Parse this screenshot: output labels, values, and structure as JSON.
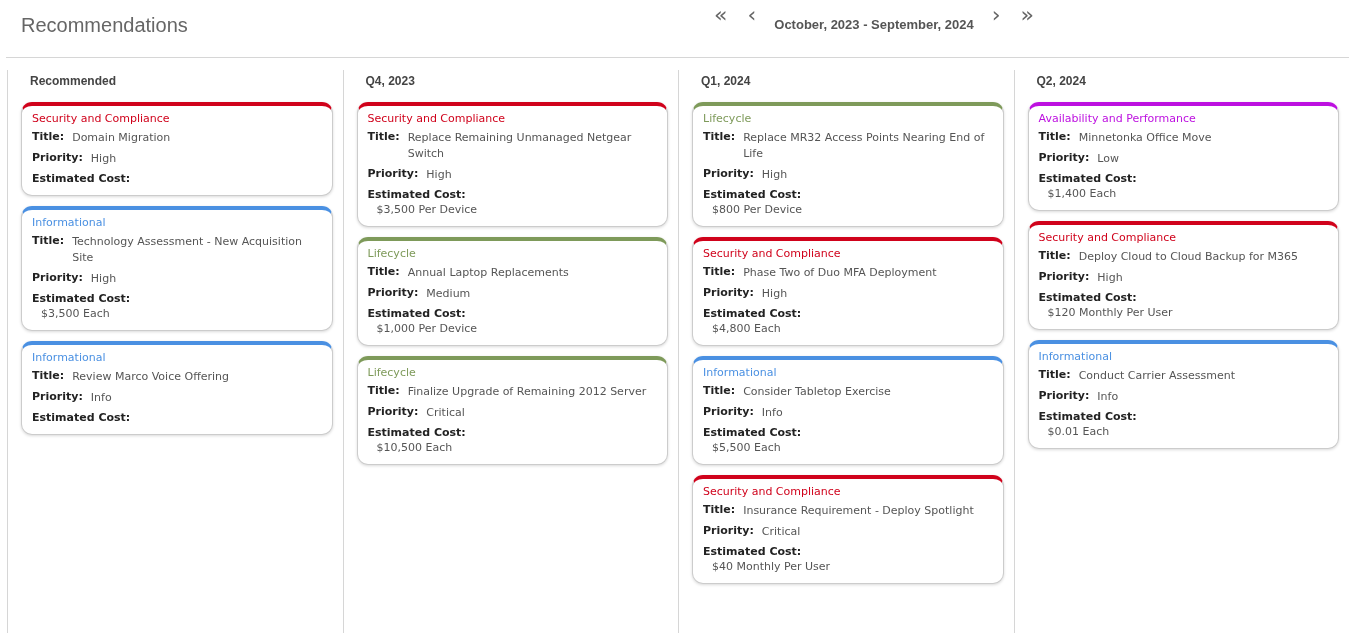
{
  "header": {
    "title": "Recommendations",
    "nav": {
      "first": "«",
      "prev": "‹",
      "range": "October, 2023 - September, 2024",
      "next": "›",
      "last": "»"
    }
  },
  "columns": [
    {
      "heading": "Recommended",
      "cards": [
        {
          "category": "Security and Compliance",
          "color": "#d0021b",
          "title_label": "Title:",
          "title": "Domain Migration",
          "priority_label": "Priority:",
          "priority": "High",
          "cost_label": "Estimated Cost:"
        },
        {
          "category": "Informational",
          "color": "#4a90e2",
          "title_label": "Title:",
          "title": "Technology Assessment - New Acquisition Site",
          "priority_label": "Priority:",
          "priority": "High",
          "cost_label": "Estimated Cost:",
          "cost": "$3,500 Each"
        },
        {
          "category": "Informational",
          "color": "#4a90e2",
          "title_label": "Title:",
          "title": "Review Marco Voice Offering",
          "priority_label": "Priority:",
          "priority": "Info",
          "cost_label": "Estimated Cost:"
        }
      ]
    },
    {
      "heading": "Q4, 2023",
      "cards": [
        {
          "category": "Security and Compliance",
          "color": "#d0021b",
          "title_label": "Title:",
          "title": "Replace Remaining Unmanaged Netgear Switch",
          "priority_label": "Priority:",
          "priority": "High",
          "cost_label": "Estimated Cost:",
          "cost": "$3,500 Per Device"
        },
        {
          "category": "Lifecycle",
          "color": "#7e9a5a",
          "title_label": "Title:",
          "title": "Annual Laptop Replacements",
          "priority_label": "Priority:",
          "priority": "Medium",
          "cost_label": "Estimated Cost:",
          "cost": "$1,000 Per Device"
        },
        {
          "category": "Lifecycle",
          "color": "#7e9a5a",
          "title_label": "Title:",
          "title": "Finalize Upgrade of Remaining 2012 Server",
          "priority_label": "Priority:",
          "priority": "Critical",
          "cost_label": "Estimated Cost:",
          "cost": "$10,500 Each"
        }
      ]
    },
    {
      "heading": "Q1, 2024",
      "cards": [
        {
          "category": "Lifecycle",
          "color": "#7e9a5a",
          "title_label": "Title:",
          "title": "Replace MR32 Access Points Nearing End of Life",
          "priority_label": "Priority:",
          "priority": "High",
          "cost_label": "Estimated Cost:",
          "cost": "$800 Per Device"
        },
        {
          "category": "Security and Compliance",
          "color": "#d0021b",
          "title_label": "Title:",
          "title": "Phase Two of Duo MFA Deployment",
          "priority_label": "Priority:",
          "priority": "High",
          "cost_label": "Estimated Cost:",
          "cost": "$4,800 Each"
        },
        {
          "category": "Informational",
          "color": "#4a90e2",
          "title_label": "Title:",
          "title": "Consider Tabletop Exercise",
          "priority_label": "Priority:",
          "priority": "Info",
          "cost_label": "Estimated Cost:",
          "cost": "$5,500 Each"
        },
        {
          "category": "Security and Compliance",
          "color": "#d0021b",
          "title_label": "Title:",
          "title": "Insurance Requirement - Deploy Spotlight",
          "priority_label": "Priority:",
          "priority": "Critical",
          "cost_label": "Estimated Cost:",
          "cost": "$40 Monthly Per User"
        }
      ]
    },
    {
      "heading": "Q2, 2024",
      "cards": [
        {
          "category": "Availability and Performance",
          "color": "#bd10e0",
          "title_label": "Title:",
          "title": "Minnetonka Office Move",
          "priority_label": "Priority:",
          "priority": "Low",
          "cost_label": "Estimated Cost:",
          "cost": "$1,400 Each"
        },
        {
          "category": "Security and Compliance",
          "color": "#d0021b",
          "title_label": "Title:",
          "title": "Deploy Cloud to Cloud Backup for M365",
          "priority_label": "Priority:",
          "priority": "High",
          "cost_label": "Estimated Cost:",
          "cost": "$120 Monthly Per User"
        },
        {
          "category": "Informational",
          "color": "#4a90e2",
          "title_label": "Title:",
          "title": "Conduct Carrier Assessment",
          "priority_label": "Priority:",
          "priority": "Info",
          "cost_label": "Estimated Cost:",
          "cost": "$0.01 Each"
        }
      ]
    }
  ]
}
